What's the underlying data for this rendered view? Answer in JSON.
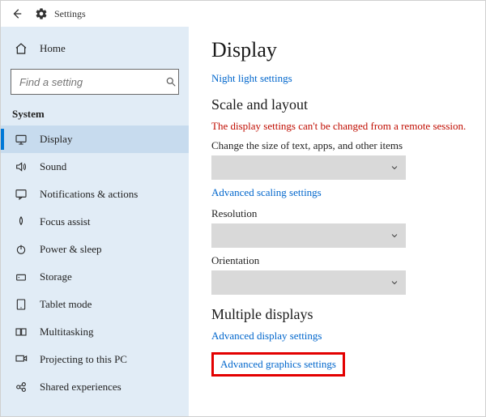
{
  "titlebar": {
    "title": "Settings"
  },
  "sidebar": {
    "home_label": "Home",
    "search_placeholder": "Find a setting",
    "section_label": "System",
    "items": [
      {
        "label": "Display"
      },
      {
        "label": "Sound"
      },
      {
        "label": "Notifications & actions"
      },
      {
        "label": "Focus assist"
      },
      {
        "label": "Power & sleep"
      },
      {
        "label": "Storage"
      },
      {
        "label": "Tablet mode"
      },
      {
        "label": "Multitasking"
      },
      {
        "label": "Projecting to this PC"
      },
      {
        "label": "Shared experiences"
      }
    ]
  },
  "content": {
    "page_title": "Display",
    "night_light_link": "Night light settings",
    "scale_heading": "Scale and layout",
    "remote_error": "The display settings can't be changed from a remote session.",
    "change_size_label": "Change the size of text, apps, and other items",
    "advanced_scaling_link": "Advanced scaling settings",
    "resolution_label": "Resolution",
    "orientation_label": "Orientation",
    "multiple_heading": "Multiple displays",
    "advanced_display_link": "Advanced display settings",
    "advanced_graphics_link": "Advanced graphics settings"
  }
}
